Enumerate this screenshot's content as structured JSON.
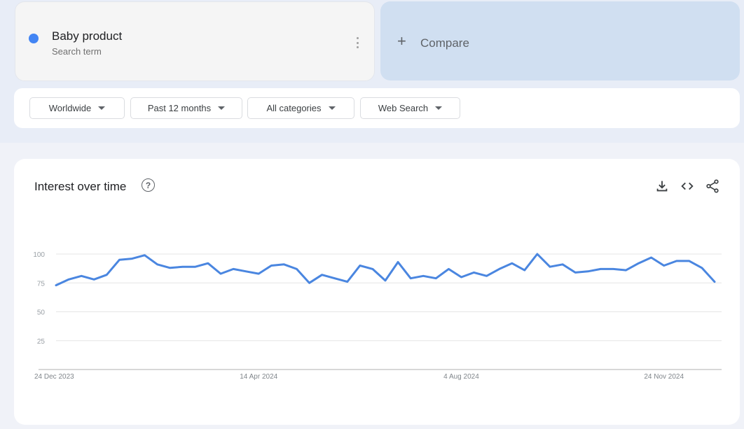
{
  "search_term": {
    "label": "Baby product",
    "type": "Search term",
    "color": "#4285f4"
  },
  "compare": {
    "icon": "plus-icon",
    "label": "Compare"
  },
  "filters": [
    {
      "label": "Worldwide"
    },
    {
      "label": "Past 12 months"
    },
    {
      "label": "All categories"
    },
    {
      "label": "Web Search"
    }
  ],
  "section": {
    "title": "Interest over time",
    "help_icon": "help-circle-icon",
    "actions": [
      "download-icon",
      "embed-code-icon",
      "share-icon"
    ]
  },
  "chart_data": {
    "type": "line",
    "title": "Interest over time",
    "xlabel": "",
    "ylabel": "",
    "ylim": [
      0,
      100
    ],
    "y_ticks": [
      25,
      50,
      75,
      100
    ],
    "x_tick_labels": [
      "24 Dec 2023",
      "14 Apr 2024",
      "4 Aug 2024",
      "24 Nov 2024"
    ],
    "x_tick_indices": [
      0,
      16,
      32,
      48
    ],
    "grid": true,
    "legend": "none",
    "series": [
      {
        "name": "Baby product",
        "color": "#4a86e0",
        "values": [
          73,
          78,
          81,
          78,
          82,
          95,
          96,
          99,
          91,
          88,
          89,
          89,
          92,
          83,
          87,
          85,
          83,
          90,
          91,
          87,
          75,
          82,
          79,
          76,
          90,
          87,
          77,
          93,
          79,
          81,
          79,
          87,
          80,
          84,
          81,
          87,
          92,
          86,
          100,
          89,
          91,
          84,
          85,
          87,
          87,
          86,
          92,
          97,
          90,
          94,
          94,
          88,
          76
        ]
      }
    ]
  }
}
